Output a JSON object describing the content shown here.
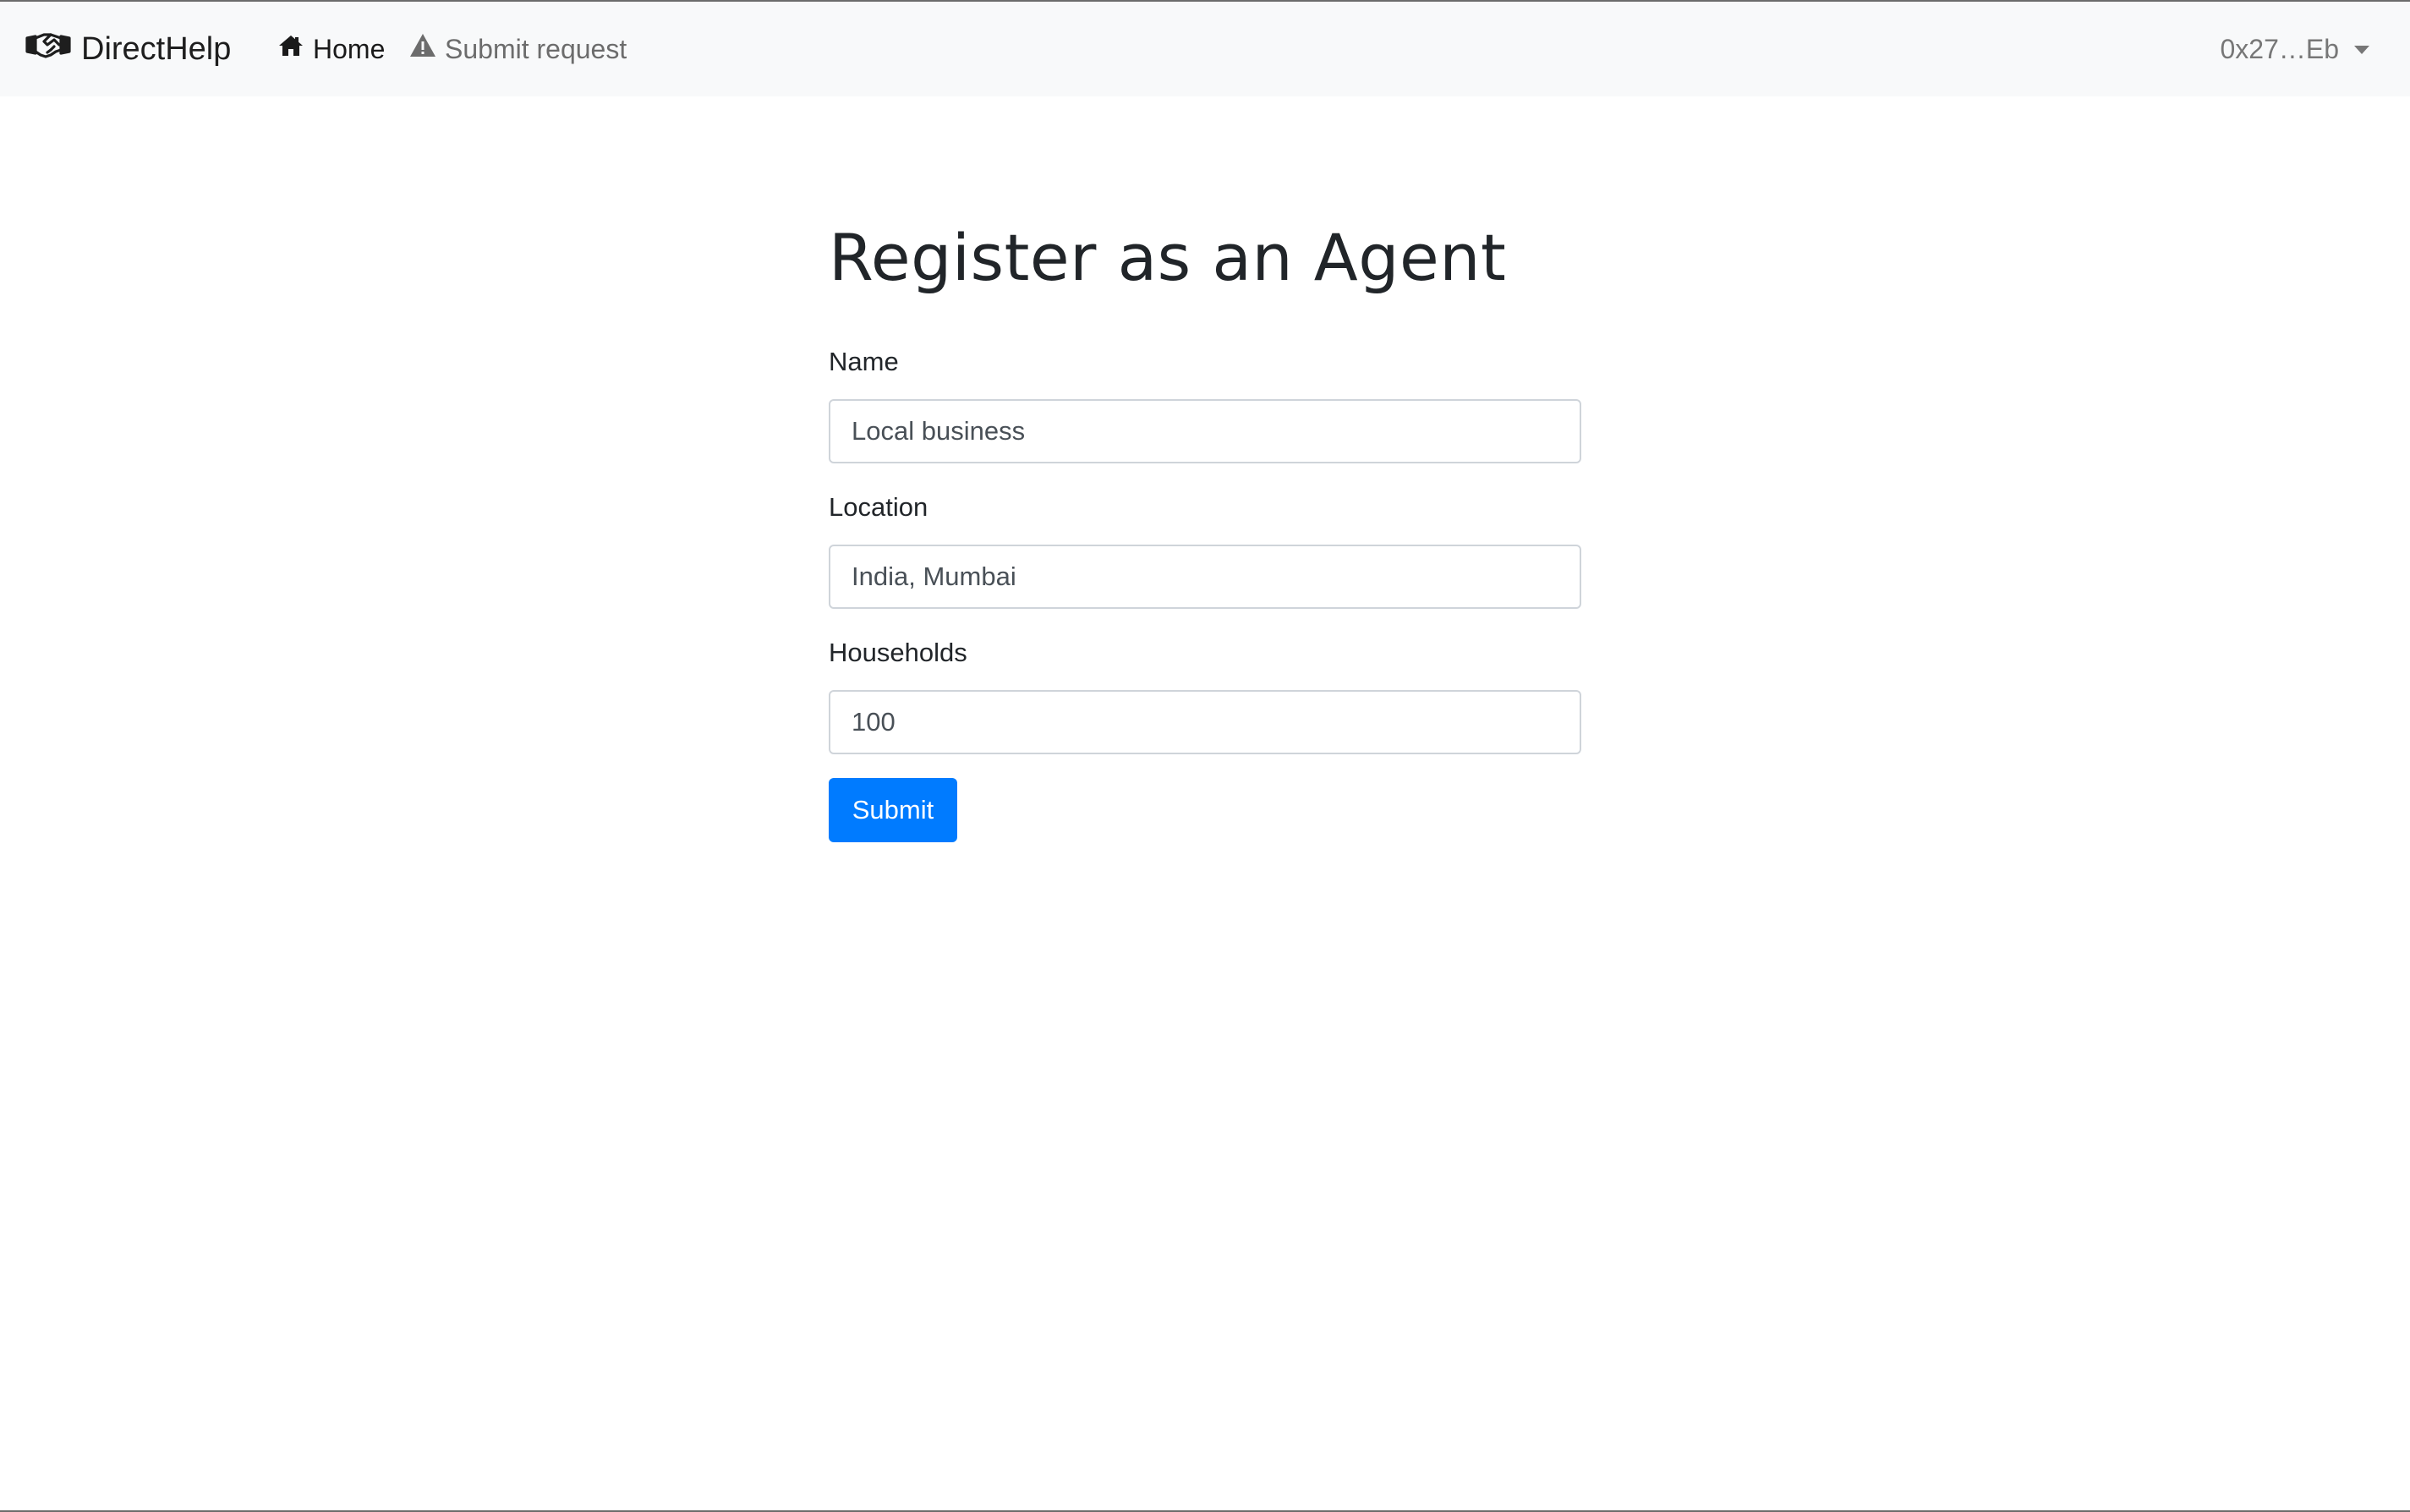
{
  "navbar": {
    "brand": "DirectHelp",
    "brand_icon": "handshake-icon",
    "links": [
      {
        "label": "Home",
        "icon": "home-icon"
      },
      {
        "label": "Submit request",
        "icon": "warning-icon"
      }
    ],
    "account": "0x27…Eb"
  },
  "form": {
    "title": "Register as an Agent",
    "fields": [
      {
        "label": "Name",
        "value": "Local business"
      },
      {
        "label": "Location",
        "value": "India, Mumbai"
      },
      {
        "label": "Households",
        "value": "100"
      }
    ],
    "submit_label": "Submit"
  },
  "colors": {
    "navbar_bg": "#f8f9fa",
    "primary": "#007bff",
    "muted_link": "#6c6c6c"
  }
}
